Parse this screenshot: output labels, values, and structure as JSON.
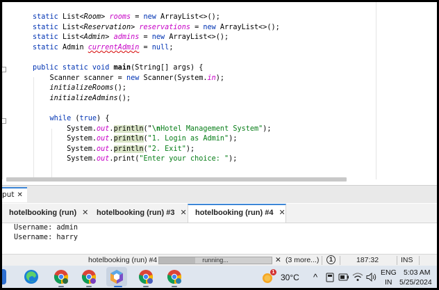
{
  "editor": {
    "lines": [
      [
        {
          "t": "static ",
          "c": "kw"
        },
        {
          "t": "List<"
        },
        {
          "t": "Room",
          "c": "it"
        },
        {
          "t": "> "
        },
        {
          "t": "rooms",
          "c": "fld"
        },
        {
          "t": " = "
        },
        {
          "t": "new",
          "c": "kw"
        },
        {
          "t": " ArrayList<>();"
        }
      ],
      [
        {
          "t": "static ",
          "c": "kw"
        },
        {
          "t": "List<"
        },
        {
          "t": "Reservation",
          "c": "it"
        },
        {
          "t": "> "
        },
        {
          "t": "reservations",
          "c": "fld"
        },
        {
          "t": " = "
        },
        {
          "t": "new",
          "c": "kw"
        },
        {
          "t": " ArrayList<>();"
        }
      ],
      [
        {
          "t": "static ",
          "c": "kw"
        },
        {
          "t": "List<"
        },
        {
          "t": "Admin",
          "c": "it"
        },
        {
          "t": "> "
        },
        {
          "t": "admins",
          "c": "fld"
        },
        {
          "t": " = "
        },
        {
          "t": "new",
          "c": "kw"
        },
        {
          "t": " ArrayList<>();"
        }
      ],
      [
        {
          "t": "static ",
          "c": "kw"
        },
        {
          "t": "Admin "
        },
        {
          "t": "currentAdmin",
          "c": "fldu"
        },
        {
          "t": " = "
        },
        {
          "t": "null",
          "c": "kw"
        },
        {
          "t": ";"
        }
      ],
      [],
      [
        {
          "t": "public static void ",
          "c": "kw"
        },
        {
          "t": "main",
          "c": "bold"
        },
        {
          "t": "(String[] args) {"
        }
      ],
      [
        {
          "t": "    Scanner scanner = "
        },
        {
          "t": "new",
          "c": "kw"
        },
        {
          "t": " Scanner(System."
        },
        {
          "t": "in",
          "c": "ostatic"
        },
        {
          "t": ");"
        }
      ],
      [
        {
          "t": "    "
        },
        {
          "t": "initializeRooms",
          "c": "it"
        },
        {
          "t": "();"
        }
      ],
      [
        {
          "t": "    "
        },
        {
          "t": "initializeAdmins",
          "c": "it"
        },
        {
          "t": "();"
        }
      ],
      [],
      [
        {
          "t": "    "
        },
        {
          "t": "while",
          "c": "kw"
        },
        {
          "t": " ("
        },
        {
          "t": "true",
          "c": "kw"
        },
        {
          "t": ") {"
        }
      ],
      [
        {
          "t": "        System."
        },
        {
          "t": "out",
          "c": "ostatic"
        },
        {
          "t": "."
        },
        {
          "t": "println",
          "c": "hl"
        },
        {
          "t": "(\""
        },
        {
          "t": "\\n",
          "c": "str bold"
        },
        {
          "t": "Hotel Management System\"",
          "c": "str"
        },
        {
          "t": ");"
        }
      ],
      [
        {
          "t": "        System."
        },
        {
          "t": "out",
          "c": "ostatic"
        },
        {
          "t": "."
        },
        {
          "t": "println",
          "c": "hl"
        },
        {
          "t": "("
        },
        {
          "t": "\"1. Login as Admin\"",
          "c": "str"
        },
        {
          "t": ");"
        }
      ],
      [
        {
          "t": "        System."
        },
        {
          "t": "out",
          "c": "ostatic"
        },
        {
          "t": "."
        },
        {
          "t": "println",
          "c": "hl"
        },
        {
          "t": "("
        },
        {
          "t": "\"2. Exit\"",
          "c": "str"
        },
        {
          "t": ");"
        }
      ],
      [
        {
          "t": "        System."
        },
        {
          "t": "out",
          "c": "ostatic"
        },
        {
          "t": ".print("
        },
        {
          "t": "\"Enter your choice: \"",
          "c": "str"
        },
        {
          "t": ");"
        }
      ]
    ]
  },
  "output_panel": {
    "tab_label": "put",
    "close_glyph": "✕"
  },
  "run_tabs": [
    {
      "label": "hotelbooking (run)",
      "close": "✕",
      "active": false
    },
    {
      "label": "hotelbooking (run) #3",
      "close": "✕",
      "active": false
    },
    {
      "label": "hotelbooking (run) #4",
      "close": "✕",
      "active": true
    }
  ],
  "console": {
    "lines": [
      "Username: admin",
      "Username: harry"
    ]
  },
  "status_bar": {
    "task": "hotelbooking (run) #4",
    "progress_label": "running...",
    "progress_fraction": 0.32,
    "cancel_glyph": "✕",
    "more": "(3 more...)",
    "notification_count": "1",
    "position": "187:32",
    "mode": "INS"
  },
  "taskbar": {
    "weather_temp": "30°C",
    "weather_badge": "1",
    "lang_top": "ENG",
    "lang_bottom": "IN",
    "time": "5:03 AM",
    "date": "5/25/2024",
    "tray_up_glyph": "^",
    "colors": {
      "chrome_red": "#db4437",
      "chrome_yellow": "#f4b400",
      "chrome_green": "#0f9d58",
      "chrome_blue": "#4285f4",
      "edge_blue": "#1b7fd6"
    }
  }
}
